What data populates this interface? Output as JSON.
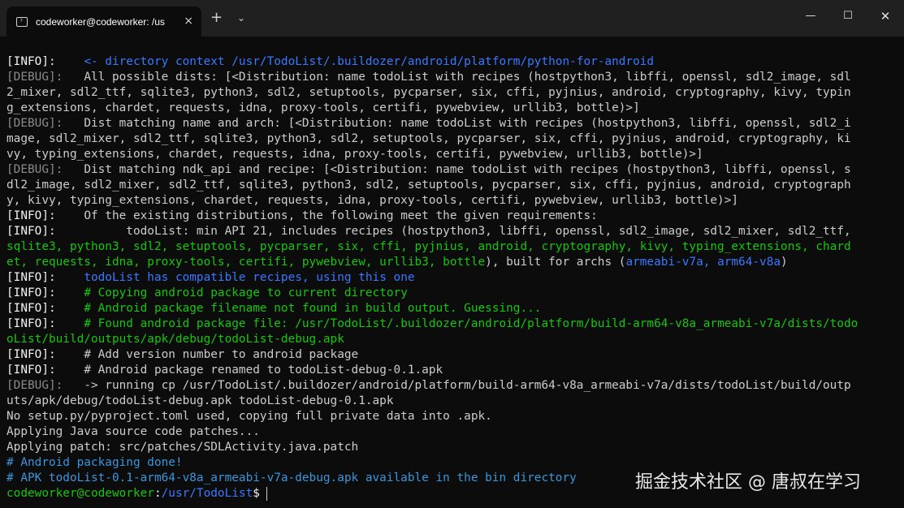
{
  "window": {
    "tab_title": "codeworker@codeworker: /us",
    "tab_close": "×",
    "new_tab": "+",
    "tab_dropdown": "⌄",
    "minimize": "—",
    "maximize": "☐",
    "close": "✕"
  },
  "terminal_lines": [
    "[INFO]:    <- directory context /usr/TodoList/.buildozer/android/platform/python-for-android",
    "[DEBUG]:   All possible dists: [<Distribution: name todoList with recipes (hostpython3, libffi, openssl, sdl2_image, sdl",
    "2_mixer, sdl2_ttf, sqlite3, python3, sdl2, setuptools, pycparser, six, cffi, pyjnius, android, cryptography, kivy, typin",
    "g_extensions, chardet, requests, idna, proxy-tools, certifi, pywebview, urllib3, bottle)>]",
    "[DEBUG]:   Dist matching name and arch: [<Distribution: name todoList with recipes (hostpython3, libffi, openssl, sdl2_i",
    "mage, sdl2_mixer, sdl2_ttf, sqlite3, python3, sdl2, setuptools, pycparser, six, cffi, pyjnius, android, cryptography, ki",
    "vy, typing_extensions, chardet, requests, idna, proxy-tools, certifi, pywebview, urllib3, bottle)>]",
    "[DEBUG]:   Dist matching ndk_api and recipe: [<Distribution: name todoList with recipes (hostpython3, libffi, openssl, s",
    "dl2_image, sdl2_mixer, sdl2_ttf, sqlite3, python3, sdl2, setuptools, pycparser, six, cffi, pyjnius, android, cryptograph",
    "y, kivy, typing_extensions, chardet, requests, idna, proxy-tools, certifi, pywebview, urllib3, bottle)>]",
    "[INFO]:    Of the existing distributions, the following meet the given requirements:",
    "[INFO]:          todoList: min API 21, includes recipes (hostpython3, libffi, openssl, sdl2_image, sdl2_mixer, sdl2_ttf,",
    "sqlite3, python3, sdl2, setuptools, pycparser, six, cffi, pyjnius, android, cryptography, kivy, typing_extensions, chard",
    "et, requests, idna, proxy-tools, certifi, pywebview, urllib3, bottle), built for archs (armeabi-v7a, arm64-v8a)",
    "[INFO]:    todoList has compatible recipes, using this one",
    "[INFO]:    # Copying android package to current directory",
    "[INFO]:    # Android package filename not found in build output. Guessing...",
    "[INFO]:    # Found android package file: /usr/TodoList/.buildozer/android/platform/build-arm64-v8a_armeabi-v7a/dists/todo",
    "oList/build/outputs/apk/debug/todoList-debug.apk",
    "[INFO]:    # Add version number to android package",
    "[INFO]:    # Android package renamed to todoList-debug-0.1.apk",
    "[DEBUG]:   -> running cp /usr/TodoList/.buildozer/android/platform/build-arm64-v8a_armeabi-v7a/dists/todoList/build/outp",
    "uts/apk/debug/todoList-debug.apk todoList-debug-0.1.apk",
    "No setup.py/pyproject.toml used, copying full private data into .apk.",
    "Applying Java source code patches...",
    "Applying patch: src/patches/SDLActivity.java.patch",
    "# Android packaging done!",
    "# APK todoList-0.1-arm64-v8a_armeabi-v7a-debug.apk available in the bin directory"
  ],
  "prompt": {
    "user": "codeworker@codeworker",
    "sep": ":",
    "path": "/usr/TodoList",
    "symbol": "$"
  },
  "watermark": "掘金技术社区 @ 唐叔在学习",
  "colors": {
    "background": "#0c0c0c",
    "titlebar": "#202020",
    "text": "#cccccc",
    "debug": "#8b8b8b",
    "blue": "#3b78ff",
    "green": "#16c60c",
    "teal": "#3a96dd"
  }
}
